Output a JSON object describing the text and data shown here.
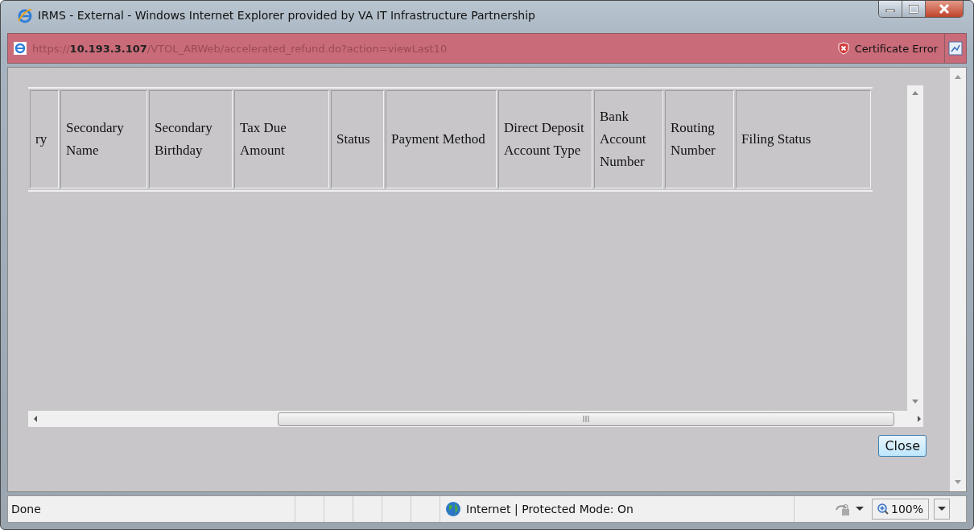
{
  "window": {
    "title": "IRMS - External - Windows Internet Explorer provided by VA IT Infrastructure Partnership"
  },
  "address_bar": {
    "url": "https://**10.193.3.107**/VTOL_ARWeb/accelerated_refund.do?action=viewLast10",
    "certificate_error": "Certificate Error"
  },
  "table": {
    "columns": [
      "ry",
      "Secondary Name",
      "Secondary Birthday",
      "Tax Due Amount",
      "Status",
      "Payment Method",
      "Direct Deposit Account Type",
      "Bank Account Number",
      "Routing Number",
      "Filing Status"
    ]
  },
  "buttons": [
    {
      "label": "Close"
    }
  ],
  "status_bar": {
    "text": "Done",
    "zone": "Internet | Protected Mode: On",
    "zoom": "100%"
  }
}
